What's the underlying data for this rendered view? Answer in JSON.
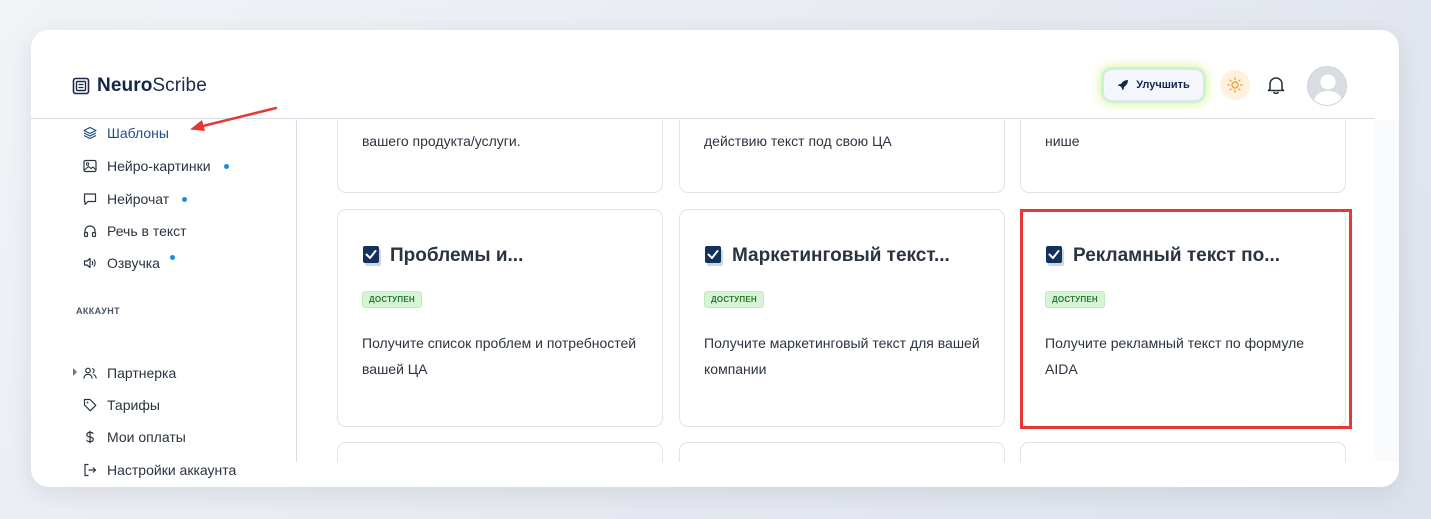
{
  "app": {
    "logo_bold": "Neuro",
    "logo_light": "Scribe"
  },
  "header": {
    "upgrade_label": "Улучшить",
    "upgrade_icon": "rocket-icon",
    "theme_icon": "sun-icon",
    "notifications_icon": "bell-icon",
    "avatar_icon": "user-avatar"
  },
  "sidebar": {
    "items": [
      {
        "label": "Шаблоны",
        "icon": "layers-icon",
        "active": true,
        "dot": false
      },
      {
        "label": "Нейро-картинки",
        "icon": "image-icon",
        "dot": true
      },
      {
        "label": "Нейрочат",
        "icon": "chat-icon",
        "dot": true
      },
      {
        "label": "Речь в текст",
        "icon": "headphones-icon",
        "dot": false
      },
      {
        "label": "Озвучка",
        "icon": "speaker-icon",
        "dot": true
      }
    ],
    "account_section_label": "АККАУНТ",
    "account_items": [
      {
        "label": "Партнерка",
        "icon": "users-icon",
        "expandable": true
      },
      {
        "label": "Тарифы",
        "icon": "tag-icon"
      },
      {
        "label": "Мои оплаты",
        "icon": "dollar-icon"
      },
      {
        "label": "Настройки аккаунта",
        "icon": "logout-icon"
      }
    ]
  },
  "cards_top_row": [
    {
      "text": "вашего продукта/услуги."
    },
    {
      "text": "действию текст под свою ЦА"
    },
    {
      "text": "нише"
    }
  ],
  "cards": [
    {
      "title": "Проблемы и...",
      "badge": "ДОСТУПЕН",
      "description": "Получите список проблем и потребностей вашей ЦА"
    },
    {
      "title": "Маркетинговый текст...",
      "badge": "ДОСТУПЕН",
      "description": "Получите маркетинговый текст для вашей компании"
    },
    {
      "title": "Рекламный текст по...",
      "badge": "ДОСТУПЕН",
      "description": "Получите рекламный текст по формуле AIDA"
    }
  ],
  "annotation_color": "#e53935",
  "accent_color": "#1a8fd6"
}
